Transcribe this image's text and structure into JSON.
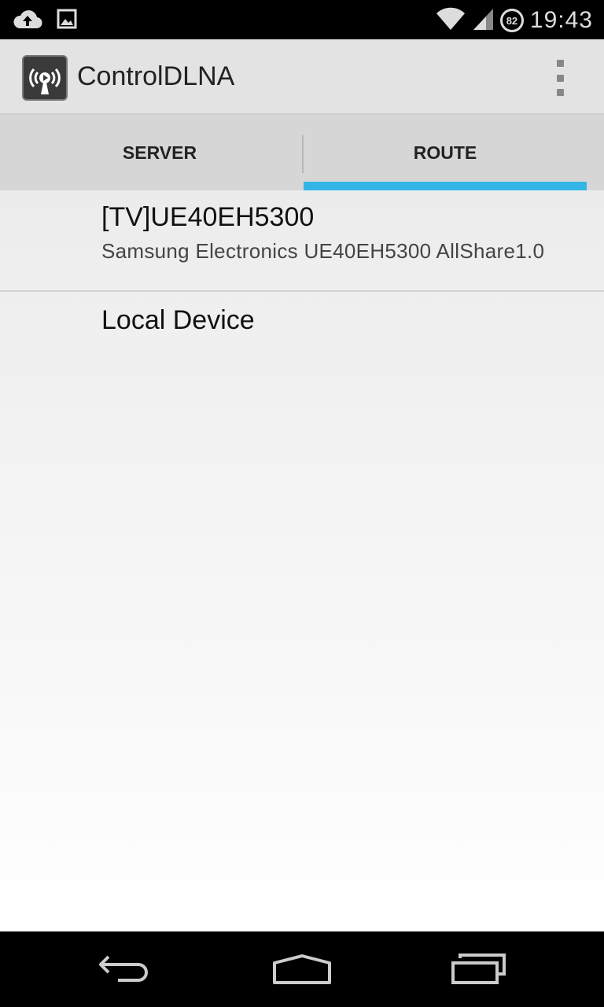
{
  "status_bar": {
    "time": "19:43",
    "battery_level": "82",
    "icons": [
      "cloud-upload-icon",
      "image-icon",
      "wifi-icon",
      "cell-signal-icon",
      "battery-icon"
    ]
  },
  "action_bar": {
    "title": "ControlDLNA",
    "icon": "dlna-app-icon",
    "overflow_icon": "overflow-menu-icon"
  },
  "tabs": [
    {
      "label": "SERVER",
      "selected": false
    },
    {
      "label": "ROUTE",
      "selected": true
    }
  ],
  "accent_color": "#33b5e5",
  "devices": [
    {
      "title": "[TV]UE40EH5300",
      "subtitle": "Samsung Electronics UE40EH5300 AllShare1.0"
    },
    {
      "title": "Local Device"
    }
  ],
  "nav_bar": {
    "icons": [
      "back-icon",
      "home-icon",
      "recents-icon"
    ]
  }
}
